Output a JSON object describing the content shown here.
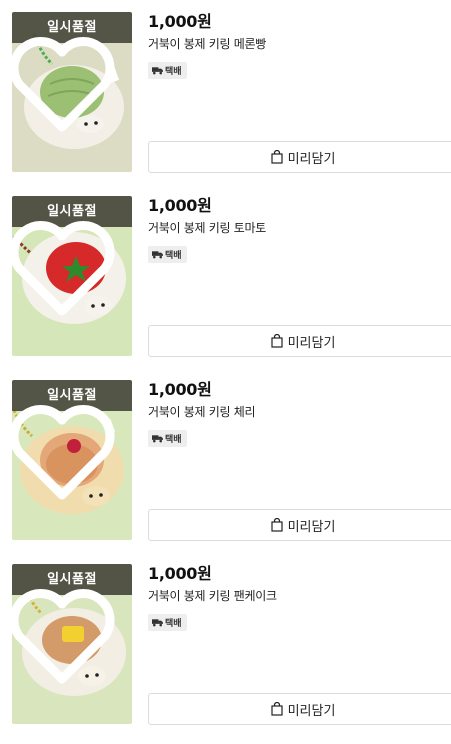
{
  "products": [
    {
      "sold_out_label": "일시품절",
      "price": "1,000원",
      "name": "거북이 봉제 키링 메론빵",
      "shipping_badge": "택배",
      "cart_button": "미리담기",
      "bg_color": "#dcdcc4",
      "patch_color": "#9bbf73",
      "chain_color": "#4cae4c",
      "icon": "heart-icon"
    },
    {
      "sold_out_label": "일시품절",
      "price": "1,000원",
      "name": "거북이 봉제 키링 토마토",
      "shipping_badge": "택배",
      "cart_button": "미리담기",
      "bg_color": "#d5e6b8",
      "patch_color": "#d62a2a",
      "chain_color": "#8b3a2a",
      "icon": "heart-icon"
    },
    {
      "sold_out_label": "일시품절",
      "price": "1,000원",
      "name": "거북이 봉제 키링 체리",
      "shipping_badge": "택배",
      "cart_button": "미리담기",
      "bg_color": "#d8e8bc",
      "patch_color": "#e4a878",
      "chain_color": "#c9b035",
      "icon": "heart-icon"
    },
    {
      "sold_out_label": "일시품절",
      "price": "1,000원",
      "name": "거북이 봉제 키링 팬케이크",
      "shipping_badge": "택배",
      "cart_button": "미리담기",
      "bg_color": "#d9e6bd",
      "patch_color": "#d39a6a",
      "chain_color": "#d4b23a",
      "icon": "heart-icon"
    }
  ]
}
